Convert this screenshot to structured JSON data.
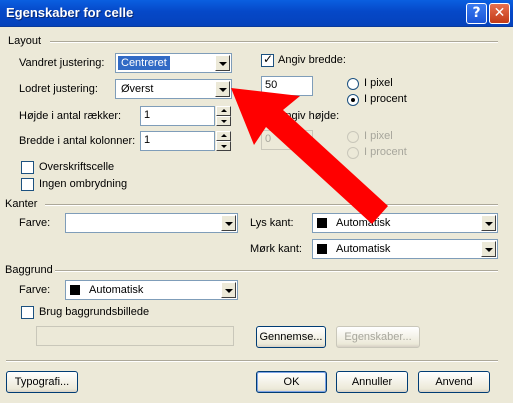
{
  "window": {
    "title": "Egenskaber for celle"
  },
  "titlebar": {
    "help_glyph": "?",
    "close_glyph": "✕"
  },
  "layout": {
    "group_label": "Layout",
    "horizontal_align_label": "Vandret justering:",
    "horizontal_align_value": "Centreret",
    "vertical_align_label": "Lodret justering:",
    "vertical_align_value": "Øverst",
    "rows_label": "Højde i antal rækker:",
    "rows_value": "1",
    "cols_label": "Bredde i antal kolonner:",
    "cols_value": "1",
    "header_cell_label": "Overskriftscelle",
    "header_cell_checked": false,
    "no_wrap_label": "Ingen ombrydning",
    "no_wrap_checked": false,
    "width_label": "Angiv bredde:",
    "width_checked": true,
    "width_value": "50",
    "width_pixel_label": "I pixel",
    "width_percent_label": "I procent",
    "width_unit_selected": "I procent",
    "height_label": "Angiv højde:",
    "height_checked": false,
    "height_value": "0",
    "height_pixel_label": "I pixel",
    "height_percent_label": "I procent"
  },
  "borders": {
    "group_label": "Kanter",
    "color_label": "Farve:",
    "color_value": "",
    "light_label": "Lys kant:",
    "light_value": "Automatisk",
    "dark_label": "Mørk kant:",
    "dark_value": "Automatisk"
  },
  "background": {
    "group_label": "Baggrund",
    "color_label": "Farve:",
    "color_value": "Automatisk",
    "image_label": "Brug baggrundsbillede",
    "image_checked": false,
    "image_path": "",
    "browse_label": "Gennemse...",
    "properties_label": "Egenskaber..."
  },
  "footer": {
    "style_label": "Typografi...",
    "ok_label": "OK",
    "cancel_label": "Annuller",
    "apply_label": "Anvend"
  },
  "annotation": {
    "arrow_color": "#ff0000"
  },
  "colors": {
    "titlebar": "#0548c8",
    "dialog_bg": "#ece9d8",
    "selection": "#316ac5"
  }
}
